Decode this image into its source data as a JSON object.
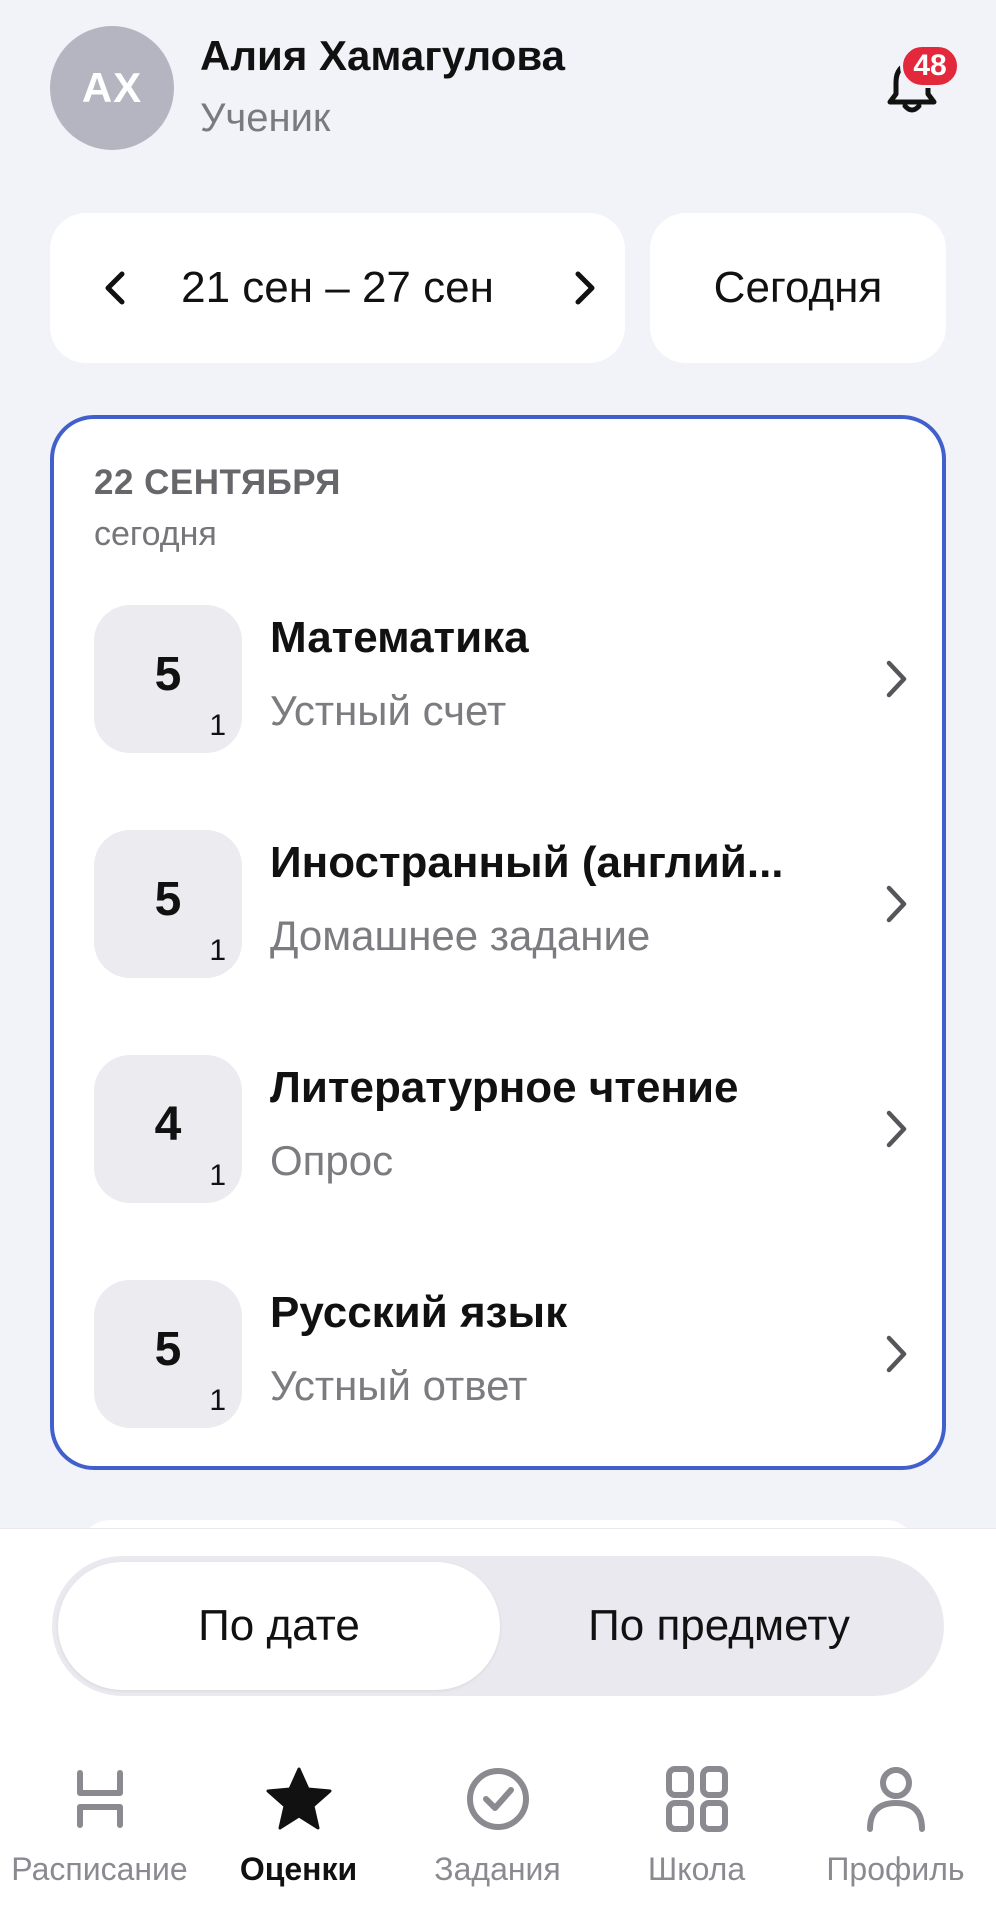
{
  "header": {
    "avatar_initials": "АХ",
    "user_name": "Алия Хамагулова",
    "user_role": "Ученик",
    "notifications_count": "48",
    "bell_icon": "bell-icon",
    "badge_color": "#e4283c"
  },
  "week": {
    "prev_icon": "chevron-left-icon",
    "range_label": "21 сен – 27 сен",
    "next_icon": "chevron-right-icon",
    "today_label": "Сегодня"
  },
  "day": {
    "date_label": "22 СЕНТЯБРЯ",
    "sub_label": "сегодня",
    "accent_color": "#4260cb",
    "lessons": [
      {
        "grade": "5",
        "weight": "1",
        "subject": "Математика",
        "work_type": "Устный счет"
      },
      {
        "grade": "5",
        "weight": "1",
        "subject": "Иностранный (англий...",
        "work_type": "Домашнее задание"
      },
      {
        "grade": "4",
        "weight": "1",
        "subject": "Литературное чтение",
        "work_type": "Опрос"
      },
      {
        "grade": "5",
        "weight": "1",
        "subject": "Русский язык",
        "work_type": "Устный ответ"
      }
    ]
  },
  "segmented": {
    "by_date": "По дате",
    "by_subject": "По предмету",
    "selected": "По дате"
  },
  "tabbar": {
    "tabs": [
      {
        "label": "Расписание",
        "icon": "schedule-icon",
        "active": false
      },
      {
        "label": "Оценки",
        "icon": "star-icon",
        "active": true
      },
      {
        "label": "Задания",
        "icon": "check-circle-icon",
        "active": false
      },
      {
        "label": "Школа",
        "icon": "grid-icon",
        "active": false
      },
      {
        "label": "Профиль",
        "icon": "person-icon",
        "active": false
      }
    ]
  }
}
